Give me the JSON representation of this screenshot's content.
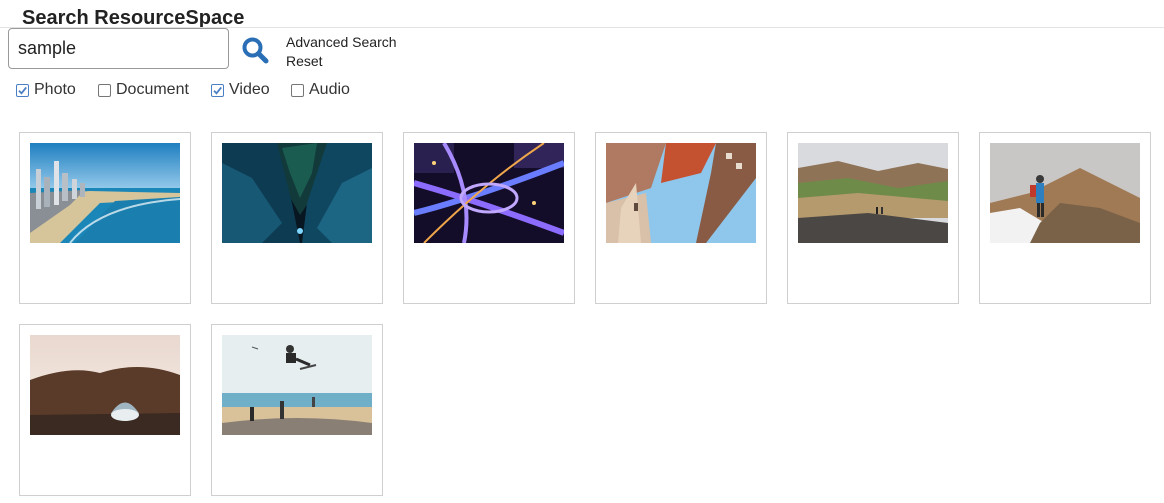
{
  "header": {
    "title": "Search ResourceSpace"
  },
  "search": {
    "value": "sample",
    "submit_icon": "search-icon",
    "links": [
      "Advanced Search",
      "Reset"
    ]
  },
  "filters": [
    {
      "label": "Photo",
      "checked": true
    },
    {
      "label": "Document",
      "checked": false
    },
    {
      "label": "Video",
      "checked": true
    },
    {
      "label": "Audio",
      "checked": false
    }
  ],
  "results": [
    {
      "subject": "coastal-city-beach"
    },
    {
      "subject": "aurora-ice-cave"
    },
    {
      "subject": "night-highway-interchange"
    },
    {
      "subject": "looking-up-buildings"
    },
    {
      "subject": "hikers-on-colorful-hills"
    },
    {
      "subject": "hiker-on-mountain-ridge"
    },
    {
      "subject": "sea-rock-arch"
    },
    {
      "subject": "skateboard-jump-beach"
    }
  ],
  "colors": {
    "accent": "#2a6fb5",
    "checkbox": "#4a7fc4",
    "card_border": "#cfcfcf"
  }
}
